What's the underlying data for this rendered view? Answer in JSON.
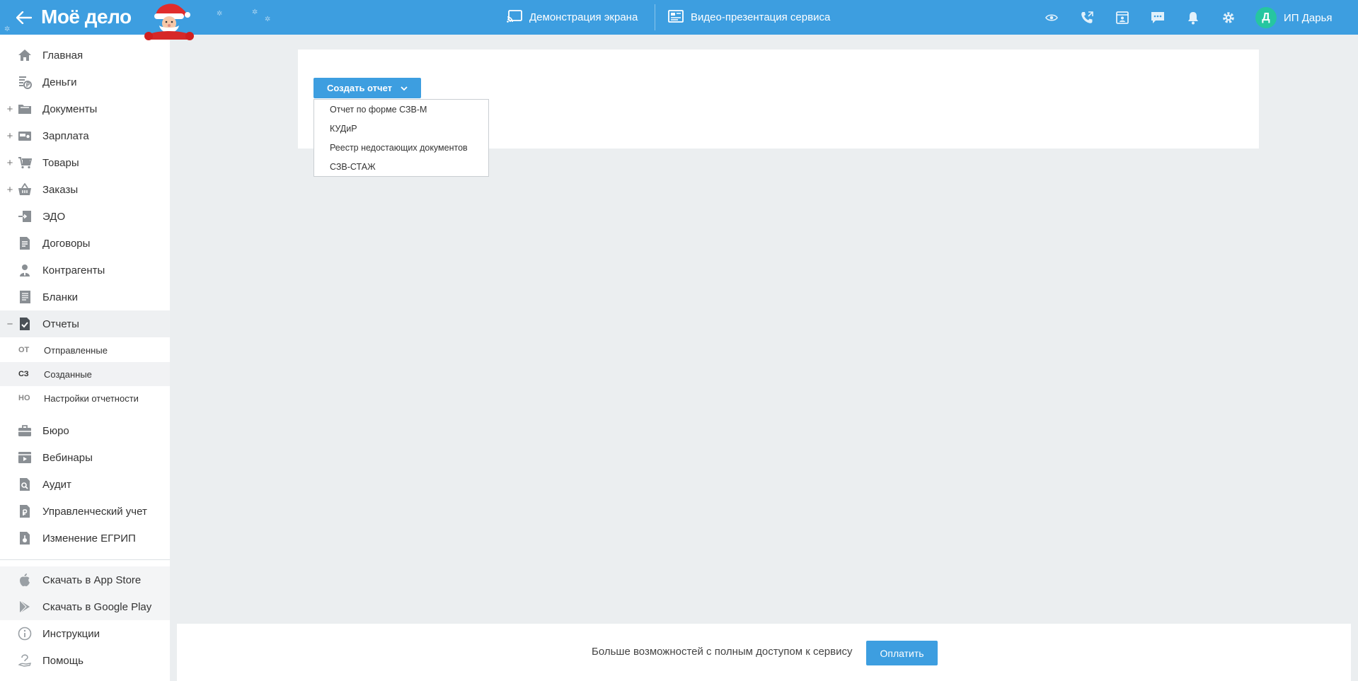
{
  "header": {
    "logo": "Моё дело",
    "screen_demo": "Демонстрация экрана",
    "video_presentation": "Видео-презентация сервиса",
    "user_initial": "Д",
    "user_name": "ИП Дарья"
  },
  "sidebar": {
    "items": [
      {
        "label": "Главная",
        "icon": "home-icon"
      },
      {
        "label": "Деньги",
        "icon": "money-icon"
      },
      {
        "label": "Документы",
        "icon": "folder-icon",
        "expand": "+"
      },
      {
        "label": "Зарплата",
        "icon": "salary-icon",
        "expand": "+"
      },
      {
        "label": "Товары",
        "icon": "cart-icon",
        "expand": "+"
      },
      {
        "label": "Заказы",
        "icon": "basket-icon",
        "expand": "+"
      },
      {
        "label": "ЭДО",
        "icon": "edo-icon"
      },
      {
        "label": "Договоры",
        "icon": "contract-icon"
      },
      {
        "label": "Контрагенты",
        "icon": "contractor-icon"
      },
      {
        "label": "Бланки",
        "icon": "forms-icon"
      },
      {
        "label": "Отчеты",
        "icon": "report-icon",
        "expand": "−"
      }
    ],
    "sub_items": [
      {
        "abbr": "ОТ",
        "label": "Отправленные"
      },
      {
        "abbr": "СЗ",
        "label": "Созданные"
      },
      {
        "abbr": "НО",
        "label": "Настройки отчетности"
      }
    ],
    "items_lower": [
      {
        "label": "Бюро",
        "icon": "briefcase-icon"
      },
      {
        "label": "Вебинары",
        "icon": "webinar-icon"
      },
      {
        "label": "Аудит",
        "icon": "audit-icon"
      },
      {
        "label": "Управленческий учет",
        "icon": "accounting-icon"
      },
      {
        "label": "Изменение ЕГРИП",
        "icon": "egrip-icon"
      }
    ],
    "apps": [
      {
        "label": "Скачать в App Store",
        "icon": "apple-icon"
      },
      {
        "label": "Скачать в Google Play",
        "icon": "google-play-icon"
      }
    ],
    "help": [
      {
        "label": "Инструкции",
        "icon": "info-icon"
      },
      {
        "label": "Помощь",
        "icon": "help-icon"
      }
    ]
  },
  "main": {
    "create_button": "Создать отчет",
    "dropdown": [
      "Отчет по форме СЗВ-М",
      "КУДиР",
      "Реестр недостающих документов",
      "СЗВ-СТАЖ"
    ]
  },
  "bottom": {
    "text": "Больше возможностей с полным доступом к сервису",
    "pay_button": "Оплатить"
  },
  "colors": {
    "header": "#3d9ee0",
    "accent": "#3d9ee0",
    "avatar": "#26c6a0",
    "background": "#ebeef0"
  }
}
